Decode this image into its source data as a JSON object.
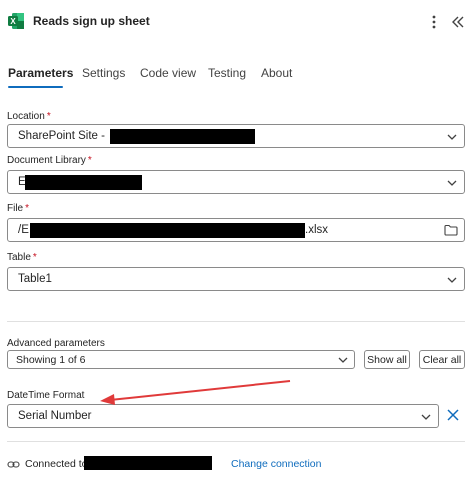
{
  "header": {
    "title": "Reads sign up sheet",
    "icon": "excel-icon",
    "more_icon": "more-vertical-icon",
    "collapse_icon": "double-chevron-left-icon"
  },
  "tabs": [
    {
      "label": "Parameters",
      "active": true
    },
    {
      "label": "Settings",
      "active": false
    },
    {
      "label": "Code view",
      "active": false
    },
    {
      "label": "Testing",
      "active": false
    },
    {
      "label": "About",
      "active": false
    }
  ],
  "fields": {
    "location": {
      "label": "Location",
      "required": "*",
      "value": "SharePoint Site -"
    },
    "document_library": {
      "label": "Document Library",
      "required": "*",
      "value": "E"
    },
    "file": {
      "label": "File",
      "required": "*",
      "value_prefix": "/E",
      "value_suffix": ".xlsx"
    },
    "table": {
      "label": "Table",
      "required": "*",
      "value": "Table1"
    }
  },
  "advanced": {
    "label": "Advanced parameters",
    "showing": "Showing 1 of 6",
    "show_all": "Show all",
    "clear_all": "Clear all"
  },
  "datetime": {
    "label": "DateTime Format",
    "value": "Serial Number"
  },
  "footer": {
    "connected_to": "Connected to",
    "change_connection": "Change connection"
  },
  "colors": {
    "accent": "#0f6cbd",
    "excel_green": "#107c41",
    "annotation_arrow": "#e03a3a",
    "required": "#c50f1f"
  }
}
